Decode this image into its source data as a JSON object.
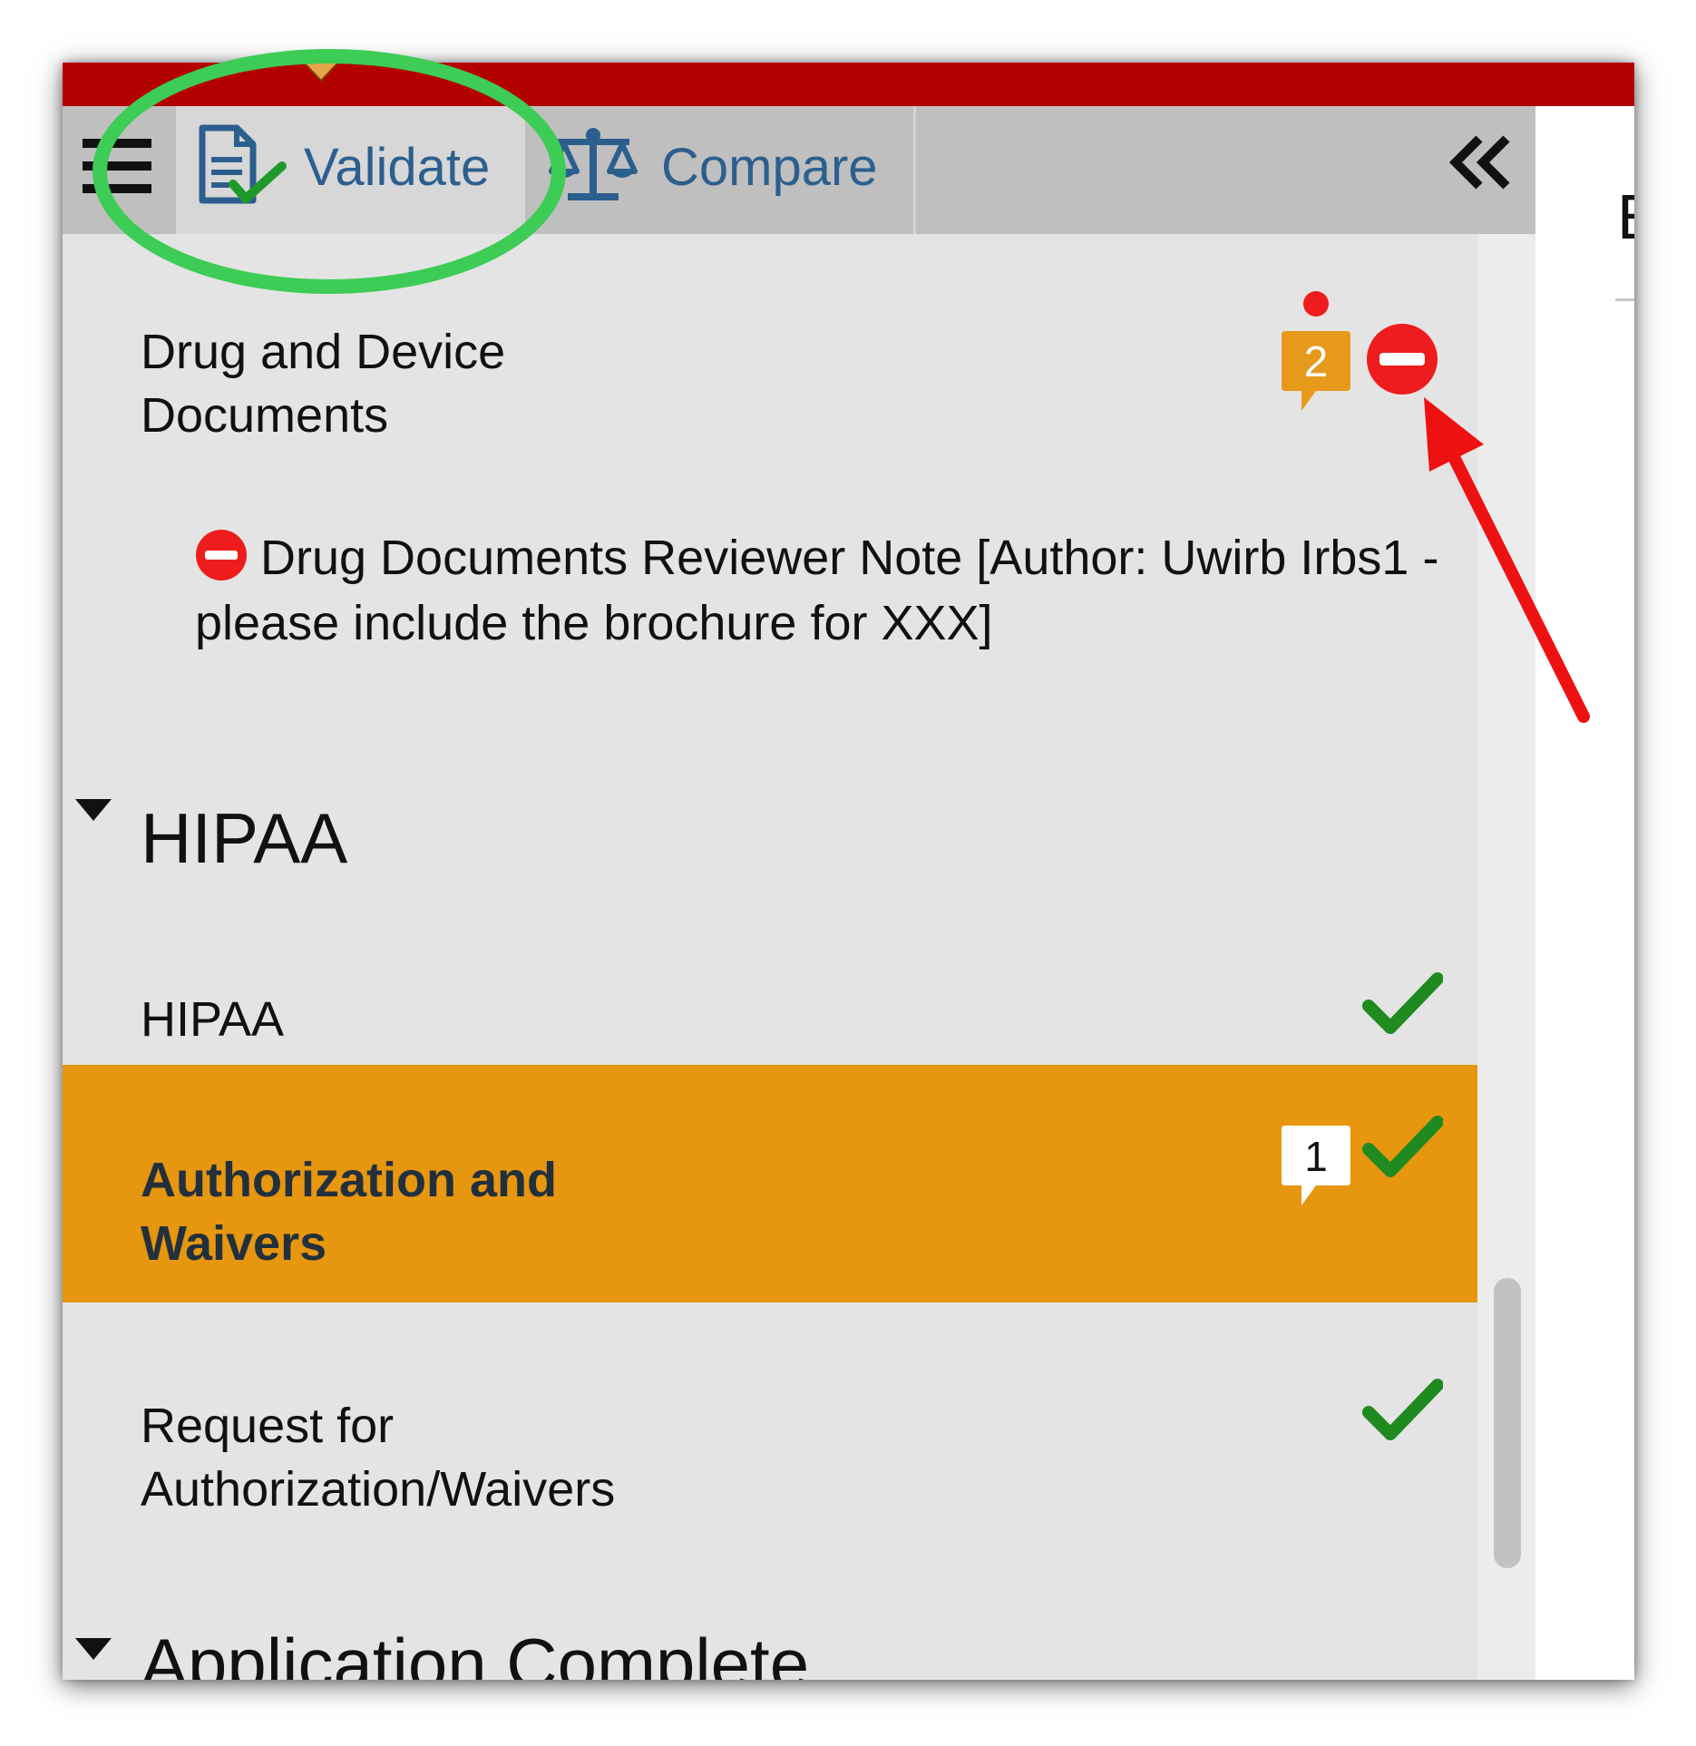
{
  "tabs": {
    "validate_label": "Validate",
    "compare_label": "Compare",
    "collapse_label": "«"
  },
  "right_pane": {
    "glyph": "E"
  },
  "sections": {
    "drug": {
      "title": "Drug and Device\nDocuments",
      "comment_count": "2",
      "note": "Drug Documents  Reviewer Note [Author: Uwirb Irbs1 - please include the brochure for XXX]"
    },
    "hipaa": {
      "heading": "HIPAA",
      "items": {
        "hipaa": "HIPAA",
        "auth": "Authorization and\nWaivers",
        "auth_comment_count": "1",
        "request": "Request for\nAuthorization/Waivers"
      }
    },
    "application_complete": {
      "heading": "Application Complete"
    }
  },
  "colors": {
    "top_bar": "#b30000",
    "tab_text": "#2c5f8e",
    "selected_row": "#e7960f",
    "check_green": "#1f8a1f",
    "error_red": "#ee1c1c",
    "badge_orange": "#e6991a",
    "annotation_oval": "#3dcc55",
    "annotation_arrow": "#ee1111"
  },
  "icons": {
    "menu": "hamburger-menu-icon",
    "validate": "document-check-icon",
    "compare": "balance-scale-icon",
    "collapse": "double-chevron-left-icon",
    "error": "minus-circle-icon",
    "ok": "checkmark-icon",
    "comment": "comment-bubble-icon"
  }
}
